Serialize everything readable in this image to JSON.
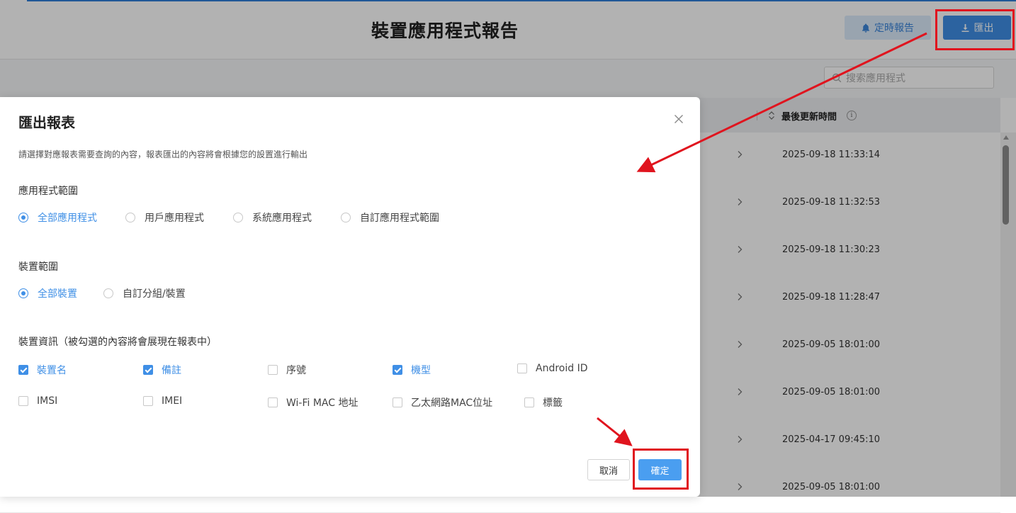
{
  "page": {
    "title": "裝置應用程式報告",
    "schedule_button": "定時報告",
    "export_button": "匯出",
    "search_placeholder": "搜索應用程式",
    "column_last_update": "最後更新時間",
    "info_glyph": "i",
    "rows": [
      {
        "time": "2025-09-18 11:33:14"
      },
      {
        "time": "2025-09-18 11:32:53"
      },
      {
        "time": "2025-09-18 11:30:23"
      },
      {
        "time": "2025-09-18 11:28:47"
      },
      {
        "time": "2025-09-05 18:01:00"
      },
      {
        "time": "2025-09-05 18:01:00"
      },
      {
        "time": "2025-04-17 09:45:10"
      },
      {
        "time": "2025-09-05 18:01:00"
      }
    ]
  },
  "modal": {
    "title": "匯出報表",
    "description": "請選擇對應報表需要查詢的內容，報表匯出的內容將會根據您的設置進行輸出",
    "app_scope": {
      "label": "應用程式範圍",
      "options": [
        {
          "label": "全部應用程式",
          "selected": true
        },
        {
          "label": "用戶應用程式",
          "selected": false
        },
        {
          "label": "系統應用程式",
          "selected": false
        },
        {
          "label": "自訂應用程式範圍",
          "selected": false
        }
      ]
    },
    "device_scope": {
      "label": "裝置範圍",
      "options": [
        {
          "label": "全部裝置",
          "selected": true
        },
        {
          "label": "自訂分組/裝置",
          "selected": false
        }
      ]
    },
    "device_info": {
      "label": "裝置資訊（被勾選的內容將會展現在報表中）",
      "options": [
        {
          "label": "裝置名",
          "checked": true
        },
        {
          "label": "備註",
          "checked": true
        },
        {
          "label": "序號",
          "checked": false
        },
        {
          "label": "機型",
          "checked": true
        },
        {
          "label": "Android ID",
          "checked": false
        },
        {
          "label": "IMSI",
          "checked": false
        },
        {
          "label": "IMEI",
          "checked": false
        },
        {
          "label": "Wi-Fi MAC 地址",
          "checked": false
        },
        {
          "label": "乙太網路MAC位址",
          "checked": false
        },
        {
          "label": "標籤",
          "checked": false
        }
      ]
    },
    "cancel_button": "取消",
    "confirm_button": "確定"
  },
  "colors": {
    "accent": "#3f8fe6",
    "annotation": "#e0141e"
  },
  "icons": [
    "bell-icon",
    "download-icon",
    "search-icon",
    "sort-icon",
    "info-icon",
    "chevron-right-icon",
    "close-icon"
  ]
}
